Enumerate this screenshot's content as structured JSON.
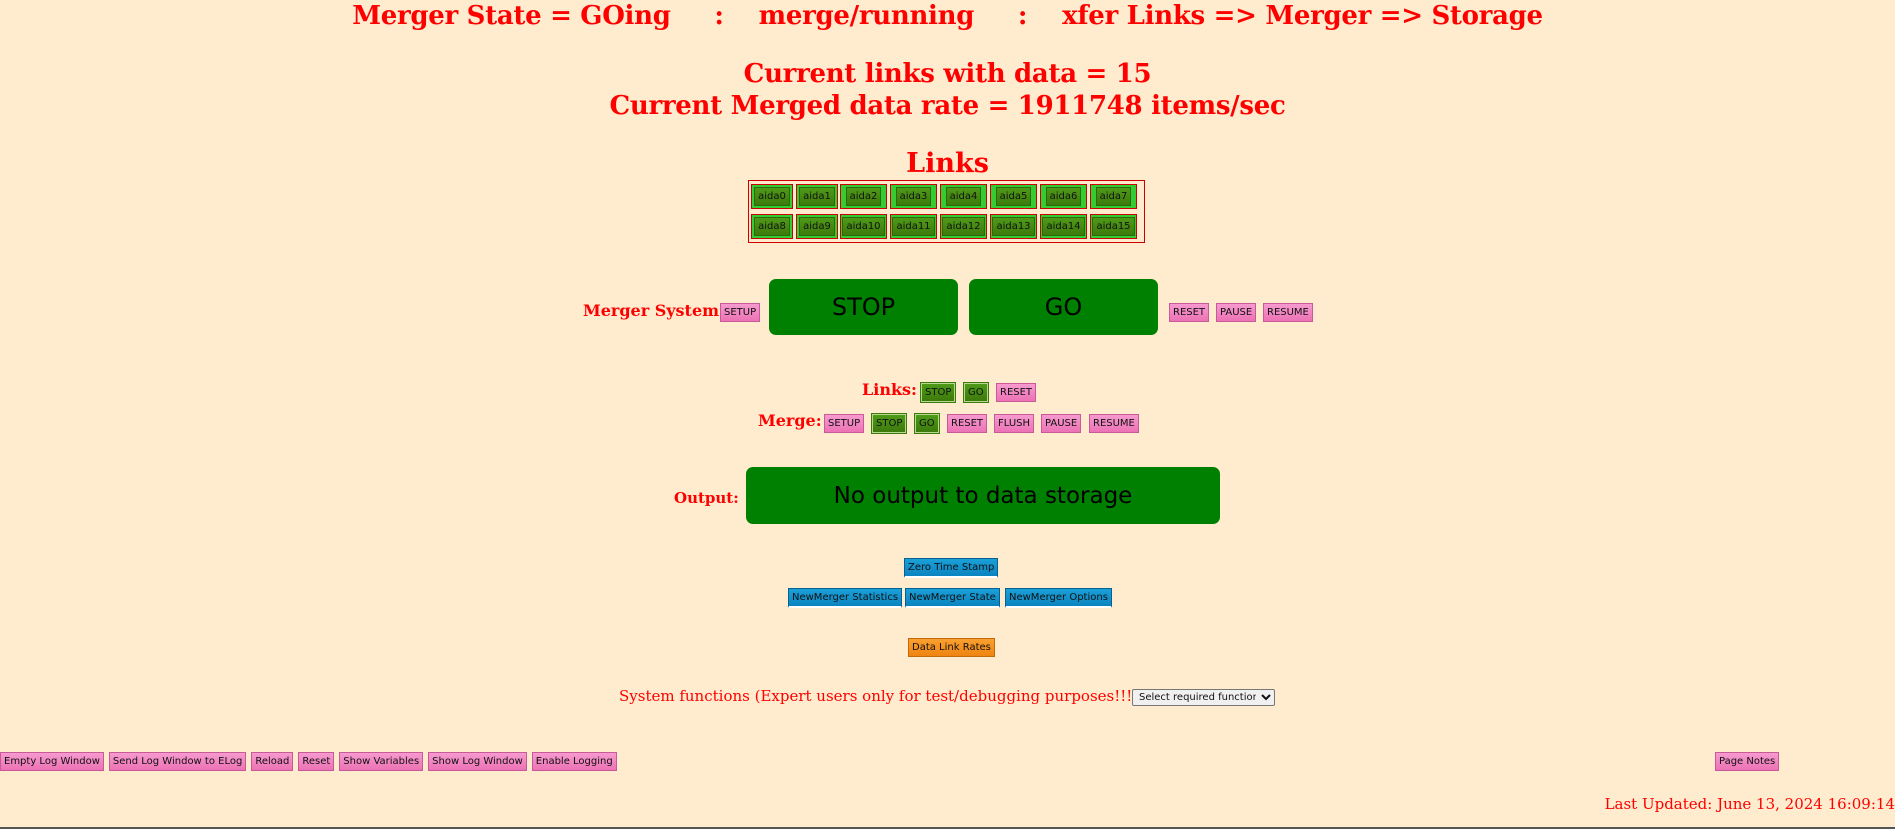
{
  "header": {
    "title": "Merger State = GOing     :    merge/running     :    xfer Links => Merger => Storage",
    "links_with_data": "Current links with data = 15",
    "data_rate": "Current Merged data rate = 1911748 items/sec"
  },
  "links": {
    "heading": "Links",
    "items": [
      "aida0",
      "aida1",
      "aida2",
      "aida3",
      "aida4",
      "aida5",
      "aida6",
      "aida7",
      "aida8",
      "aida9",
      "aida10",
      "aida11",
      "aida12",
      "aida13",
      "aida14",
      "aida15"
    ],
    "status_color": "#33cc33"
  },
  "merger_system": {
    "label": "Merger System:",
    "setup": "SETUP",
    "stop": "STOP",
    "go": "GO",
    "reset": "RESET",
    "pause": "PAUSE",
    "resume": "RESUME"
  },
  "links_controls": {
    "label": "Links:",
    "stop": "STOP",
    "go": "GO",
    "reset": "RESET"
  },
  "merge_controls": {
    "label": "Merge:",
    "setup": "SETUP",
    "stop": "STOP",
    "go": "GO",
    "reset": "RESET",
    "flush": "FLUSH",
    "pause": "PAUSE",
    "resume": "RESUME"
  },
  "output": {
    "label": "Output:",
    "status": "No output to data storage"
  },
  "tools": {
    "zero_time_stamp": "Zero Time Stamp",
    "statistics": "NewMerger Statistics",
    "state": "NewMerger State",
    "options": "NewMerger Options",
    "data_link_rates": "Data Link Rates"
  },
  "system_functions": {
    "label": "System functions (Expert users only for test/debugging purposes!!!)",
    "select_value": "Select required function"
  },
  "footer": {
    "buttons": [
      "Empty Log Window",
      "Send Log Window to ELog",
      "Reload",
      "Reset",
      "Show Variables",
      "Show Log Window",
      "Enable Logging"
    ],
    "page_notes": "Page Notes",
    "last_updated": "Last Updated: June 13, 2024 16:09:14"
  },
  "colors": {
    "background": "#ffebcd",
    "text_red": "#ff0000",
    "big_green": "#008000",
    "pink": "#ec72b4",
    "blue": "#0b84c0",
    "orange": "#ef8410"
  }
}
